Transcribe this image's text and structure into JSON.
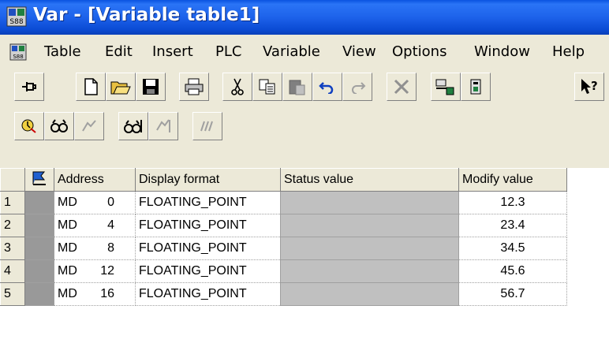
{
  "window": {
    "title": "Var - [Variable table1]"
  },
  "menu": [
    "Table",
    "Edit",
    "Insert",
    "PLC",
    "Variable",
    "View",
    "Options",
    "Window",
    "Help"
  ],
  "toolbar1": [
    "pin-icon",
    "new-file-icon",
    "open-folder-icon",
    "save-icon",
    "print-icon",
    "cut-icon",
    "copy-icon",
    "paste-icon",
    "undo-icon",
    "redo-icon",
    "delete-icon",
    "accessible-nodes-icon",
    "simatic-manager-icon",
    "help-pointer-icon"
  ],
  "toolbar2": [
    "monitor-trigger-icon",
    "monitor-variable-icon",
    "modify-variable-icon",
    "update-monitor-icon",
    "activate-modify-icon",
    "force-icon"
  ],
  "table": {
    "headers": {
      "address": "Address",
      "display_format": "Display format",
      "status_value": "Status value",
      "modify_value": "Modify value"
    },
    "rows": [
      {
        "num": "1",
        "area": "MD",
        "offset": "0",
        "format": "FLOATING_POINT",
        "status": "",
        "modify": "12.3"
      },
      {
        "num": "2",
        "area": "MD",
        "offset": "4",
        "format": "FLOATING_POINT",
        "status": "",
        "modify": "23.4"
      },
      {
        "num": "3",
        "area": "MD",
        "offset": "8",
        "format": "FLOATING_POINT",
        "status": "",
        "modify": "34.5"
      },
      {
        "num": "4",
        "area": "MD",
        "offset": "12",
        "format": "FLOATING_POINT",
        "status": "",
        "modify": "45.6"
      },
      {
        "num": "5",
        "area": "MD",
        "offset": "16",
        "format": "FLOATING_POINT",
        "status": "",
        "modify": "56.7"
      }
    ]
  }
}
